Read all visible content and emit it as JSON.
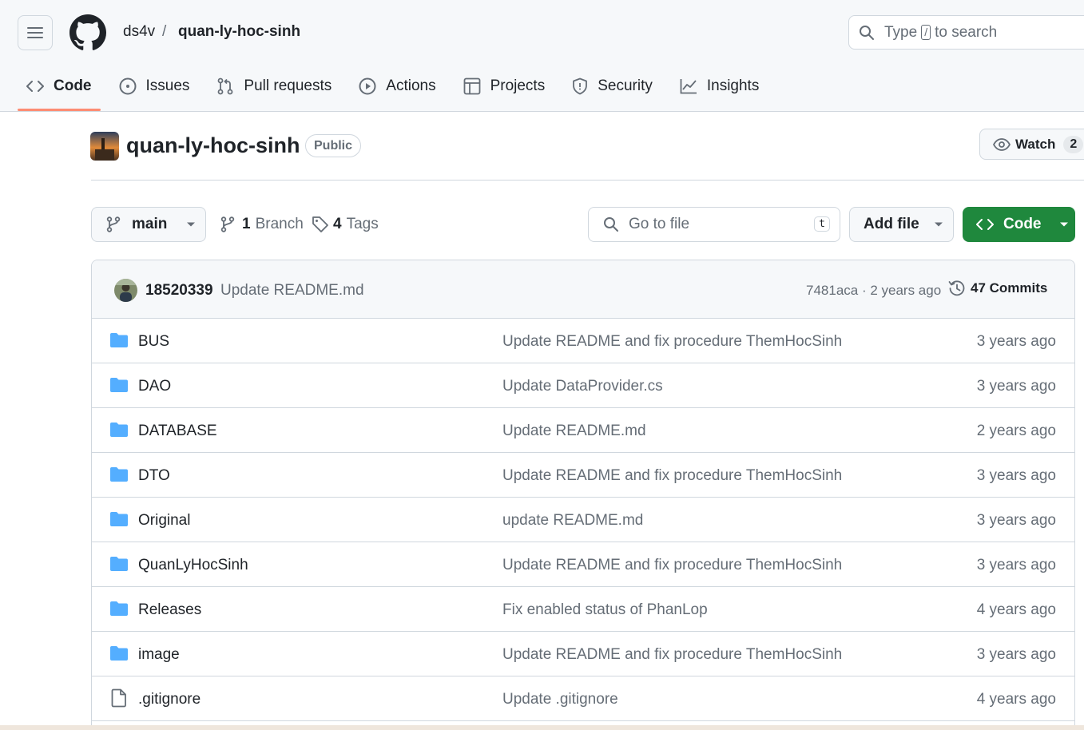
{
  "header": {
    "owner": "ds4v",
    "separator": "/",
    "repo": "quan-ly-hoc-sinh",
    "search_prefix": "Type",
    "search_key": "/",
    "search_suffix": "to search"
  },
  "tabs": [
    {
      "label": "Code",
      "icon": "code-icon",
      "active": true
    },
    {
      "label": "Issues",
      "icon": "issue-icon"
    },
    {
      "label": "Pull requests",
      "icon": "pull-request-icon"
    },
    {
      "label": "Actions",
      "icon": "play-icon"
    },
    {
      "label": "Projects",
      "icon": "table-icon"
    },
    {
      "label": "Security",
      "icon": "shield-icon"
    },
    {
      "label": "Insights",
      "icon": "graph-icon"
    }
  ],
  "repo_header": {
    "title": "quan-ly-hoc-sinh",
    "visibility": "Public",
    "watch_label": "Watch",
    "watch_count": "2"
  },
  "toolbar": {
    "branch": "main",
    "branches_count": "1",
    "branches_label": "Branch",
    "tags_count": "4",
    "tags_label": "Tags",
    "goto_placeholder": "Go to file",
    "goto_key": "t",
    "add_file_label": "Add file",
    "code_label": "Code"
  },
  "latest_commit": {
    "author": "18520339",
    "message": "Update README.md",
    "meta": "7481aca · 2 years ago",
    "commits_label": "47 Commits"
  },
  "files": [
    {
      "name": "BUS",
      "type": "folder",
      "message": "Update README and fix procedure ThemHocSinh",
      "age": "3 years ago"
    },
    {
      "name": "DAO",
      "type": "folder",
      "message": "Update DataProvider.cs",
      "age": "3 years ago"
    },
    {
      "name": "DATABASE",
      "type": "folder",
      "message": "Update README.md",
      "age": "2 years ago"
    },
    {
      "name": "DTO",
      "type": "folder",
      "message": "Update README and fix procedure ThemHocSinh",
      "age": "3 years ago"
    },
    {
      "name": "Original",
      "type": "folder",
      "message": "update README.md",
      "age": "3 years ago"
    },
    {
      "name": "QuanLyHocSinh",
      "type": "folder",
      "message": "Update README and fix procedure ThemHocSinh",
      "age": "3 years ago"
    },
    {
      "name": "Releases",
      "type": "folder",
      "message": "Fix enabled status of PhanLop",
      "age": "4 years ago"
    },
    {
      "name": "image",
      "type": "folder",
      "message": "Update README and fix procedure ThemHocSinh",
      "age": "3 years ago"
    },
    {
      "name": ".gitignore",
      "type": "file",
      "message": "Update .gitignore",
      "age": "4 years ago"
    }
  ],
  "colors": {
    "accent_underline": "#fd8c73",
    "code_button": "#1f883d",
    "folder": "#54aeff"
  }
}
